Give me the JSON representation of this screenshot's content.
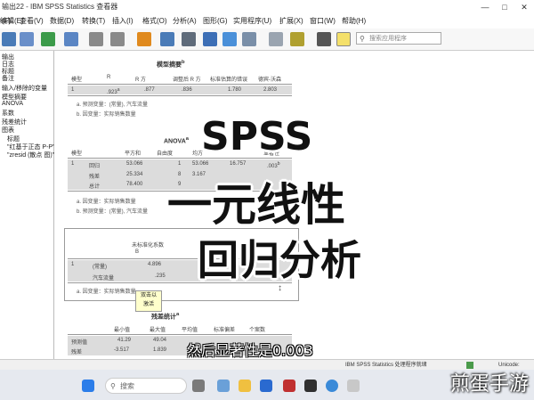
{
  "window": {
    "title": "输出22 - IBM SPSS Statistics 查看器",
    "min": "—",
    "max": "□",
    "close": "✕"
  },
  "menu": [
    "文件(F)",
    "编辑(E)",
    "查看(V)",
    "数据(D)",
    "转换(T)",
    "插入(I)",
    "格式(O)",
    "分析(A)",
    "图形(G)",
    "实用程序(U)",
    "扩展(X)",
    "窗口(W)",
    "帮助(H)"
  ],
  "search": {
    "placeholder": "搜索应用程序"
  },
  "outline": [
    "输出",
    "日志",
    "标题",
    "备注",
    "输入/移除的变量",
    "模型摘要",
    "ANOVA",
    "系数",
    "残差统计",
    "图表",
    "标题",
    "\"红基于正态 P-P\"",
    "\"zresid (散点 图)\""
  ],
  "model_summary": {
    "title": "模型摘要",
    "title_sup": "b",
    "headers": [
      "模型",
      "R",
      "R 方",
      "调整后 R 方",
      "标准估算的错误",
      "德宾-沃森"
    ],
    "row": [
      "1",
      ".923",
      ".877",
      ".836",
      "1.780",
      "2.803"
    ],
    "r_sup": "a",
    "notes": [
      "a. 预测变量：(常量), 汽车流量",
      "b. 因变量：实际销售数量"
    ]
  },
  "anova": {
    "title": "ANOVA",
    "title_sup": "a",
    "headers": [
      "模型",
      "",
      "平方和",
      "自由度",
      "均方",
      "F",
      "显著性"
    ],
    "model": "1",
    "rows": [
      [
        "回归",
        "53.066",
        "1",
        "53.066",
        "16.757",
        ".003"
      ],
      [
        "残差",
        "25.334",
        "8",
        "3.167",
        "",
        ""
      ],
      [
        "总计",
        "78.400",
        "9",
        "",
        "",
        ""
      ]
    ],
    "sig_sup": "b",
    "notes": [
      "a. 因变量：实际销售数量",
      "b. 预测变量：(常量), 汽车流量"
    ]
  },
  "coefficients": {
    "header_top": "未标准化系数",
    "header_b": "B",
    "model": "1",
    "rows": [
      [
        "(常量)",
        "4.896"
      ],
      [
        "汽车流量",
        ".235"
      ]
    ],
    "notes": [
      "a. 因变量：实际销售数量"
    ]
  },
  "tooltip": [
    "双击以",
    "激活"
  ],
  "residuals": {
    "title": "残差统计",
    "title_sup": "a",
    "headers": [
      "",
      "最小值",
      "最大值",
      "平均值",
      "标准偏差",
      "个案数"
    ],
    "rows": [
      [
        "预测值",
        "41.29",
        "49.04",
        "",
        "",
        ""
      ],
      [
        "残差",
        "-3.517",
        "1.839",
        "",
        "",
        ""
      ]
    ]
  },
  "overlay": {
    "line1": "SPSS",
    "line2": "一元线性",
    "line3": "回归分析"
  },
  "subtitle": "然后显著性是0.003",
  "status": {
    "processor": "IBM SPSS Statistics 处理程序就绪",
    "encoding": "Unicode:"
  },
  "taskbar": {
    "search": "搜索"
  },
  "watermark": "煎蛋手游"
}
